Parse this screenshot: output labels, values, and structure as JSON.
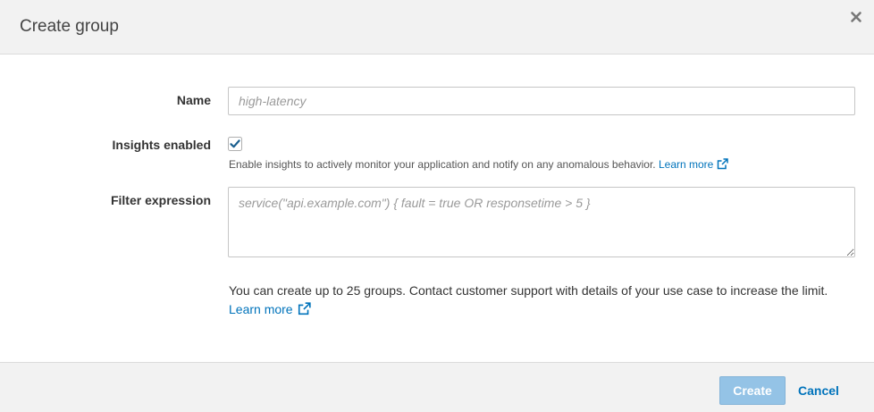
{
  "dialog": {
    "title": "Create group",
    "close_icon": "close-icon"
  },
  "form": {
    "name": {
      "label": "Name",
      "value": "",
      "placeholder": "high-latency"
    },
    "insights": {
      "label": "Insights enabled",
      "checked": true,
      "help_text": "Enable insights to actively monitor your application and notify on any anomalous behavior.",
      "learn_more_label": "Learn more",
      "learn_more_icon": "external-link-icon"
    },
    "filter_expression": {
      "label": "Filter expression",
      "value": "",
      "placeholder": "service(\"api.example.com\") { fault = true OR responsetime > 5 }"
    }
  },
  "info": {
    "text": "You can create up to 25 groups. Contact customer support with details of your use case to increase the limit.",
    "learn_more_label": "Learn more",
    "learn_more_icon": "external-link-icon"
  },
  "footer": {
    "create_label": "Create",
    "cancel_label": "Cancel"
  },
  "colors": {
    "accent": "#0073bb",
    "primary_button_disabled": "#94c3e6",
    "checkbox_check": "#1a5f8f"
  }
}
